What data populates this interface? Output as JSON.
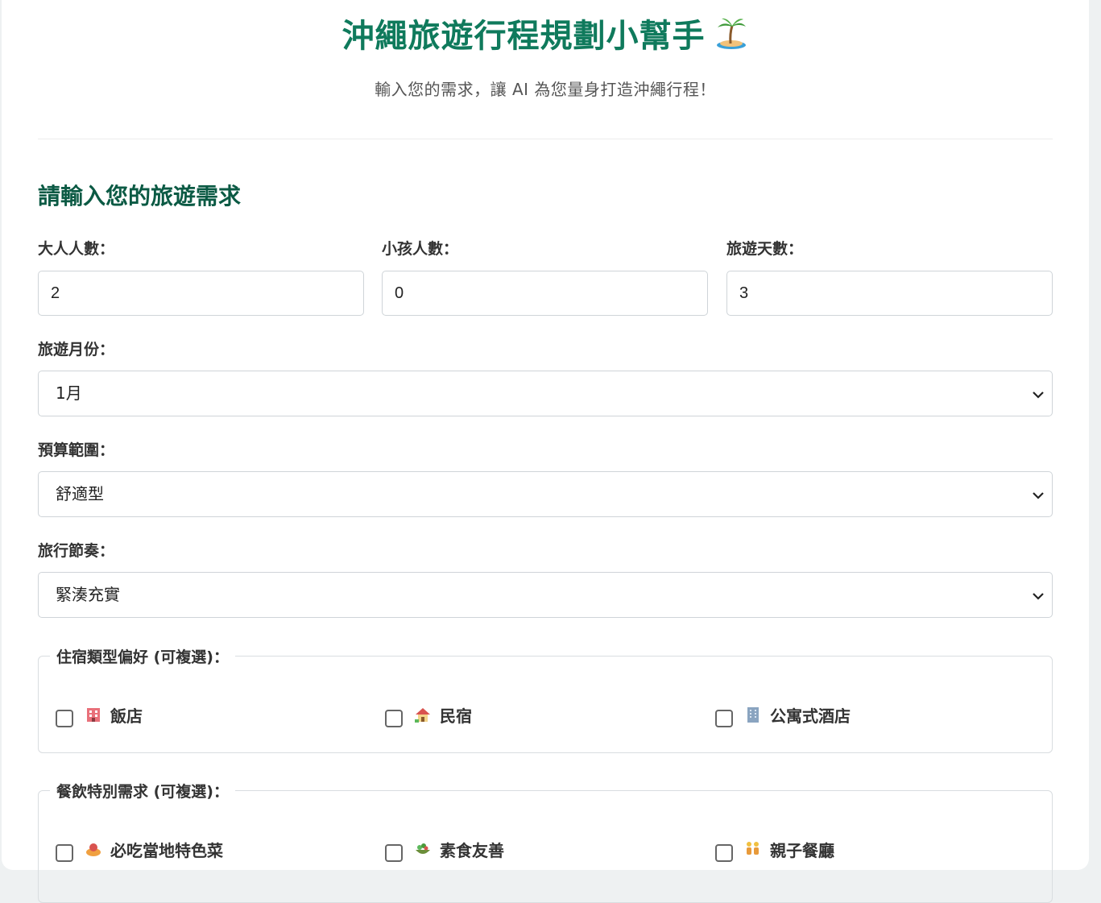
{
  "header": {
    "title": "沖繩旅遊行程規劃小幫手",
    "title_icon": "palm-island-icon",
    "subtitle": "輸入您的需求，讓 AI 為您量身打造沖繩行程！"
  },
  "form": {
    "section_title": "請輸入您的旅遊需求",
    "adults": {
      "label": "大人人數：",
      "value": "2"
    },
    "children": {
      "label": "小孩人數：",
      "value": "0"
    },
    "days": {
      "label": "旅遊天數：",
      "value": "3"
    },
    "month": {
      "label": "旅遊月份：",
      "selected": "1月"
    },
    "budget": {
      "label": "預算範圍：",
      "selected": "舒適型"
    },
    "pace": {
      "label": "旅行節奏：",
      "selected": "緊湊充實"
    },
    "accommodation": {
      "legend": "住宿類型偏好 (可複選)：",
      "options": [
        {
          "label": "飯店",
          "icon": "hotel-icon",
          "checked": false
        },
        {
          "label": "民宿",
          "icon": "house-icon",
          "checked": false
        },
        {
          "label": "公寓式酒店",
          "icon": "office-building-icon",
          "checked": false
        }
      ]
    },
    "dining": {
      "legend": "餐飲特別需求 (可複選)：",
      "options": [
        {
          "label": "必吃當地特色菜",
          "icon": "food-icon",
          "checked": false
        },
        {
          "label": "素食友善",
          "icon": "salad-icon",
          "checked": false
        },
        {
          "label": "親子餐廳",
          "icon": "family-icon",
          "checked": false
        }
      ]
    }
  },
  "colors": {
    "title_green": "#0f7a5c",
    "section_green": "#0b5a44"
  }
}
